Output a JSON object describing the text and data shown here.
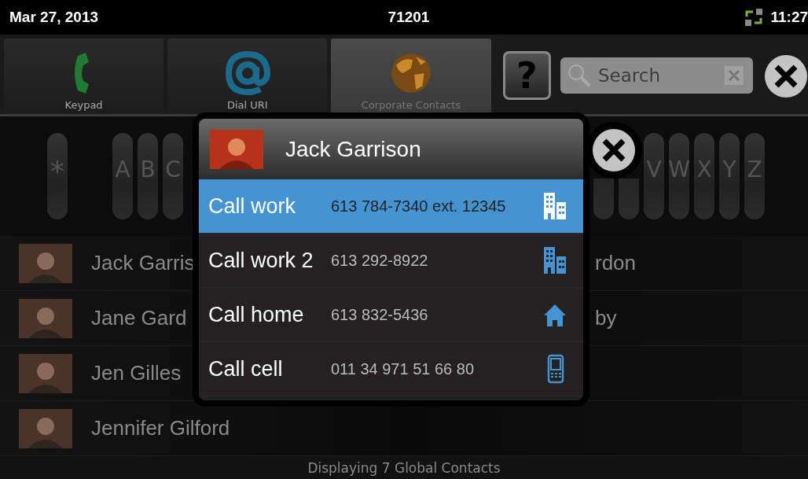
{
  "status_bar": {
    "date": "Mar 27, 2013",
    "extension": "71201",
    "time": "11:27"
  },
  "tabs": [
    {
      "label": "Keypad",
      "kind": "phone",
      "selected": false
    },
    {
      "label": "Dial URI",
      "kind": "at",
      "selected": false
    },
    {
      "label": "Corporate Contacts",
      "kind": "globe",
      "selected": true
    }
  ],
  "help_button": {
    "label": "?"
  },
  "search": {
    "placeholder": "Search"
  },
  "index_bar": {
    "star": "*",
    "letters_left": [
      "A",
      "B",
      "C"
    ],
    "letters_right": [
      "V",
      "W",
      "X",
      "Y",
      "Z"
    ]
  },
  "contacts": [
    {
      "name": "Jack Garris",
      "column_2": "rdon"
    },
    {
      "name": "Jane Gard",
      "column_2": "by"
    },
    {
      "name": "Jen Gilles"
    },
    {
      "name": "Jennifer Gilford"
    }
  ],
  "footer": "Displaying 7 Global Contacts",
  "dialog": {
    "name": "Jack Garrison",
    "options": [
      {
        "label": "Call work",
        "number": "613 784-7340 ext. 12345",
        "kind": "work",
        "selected": true
      },
      {
        "label": "Call work 2",
        "number": "613 292-8922",
        "kind": "work",
        "selected": false
      },
      {
        "label": "Call home",
        "number": "613 832-5436",
        "kind": "home",
        "selected": false
      },
      {
        "label": "Call cell",
        "number": "011 34 971 51 66 80",
        "kind": "cell",
        "selected": false
      }
    ]
  }
}
